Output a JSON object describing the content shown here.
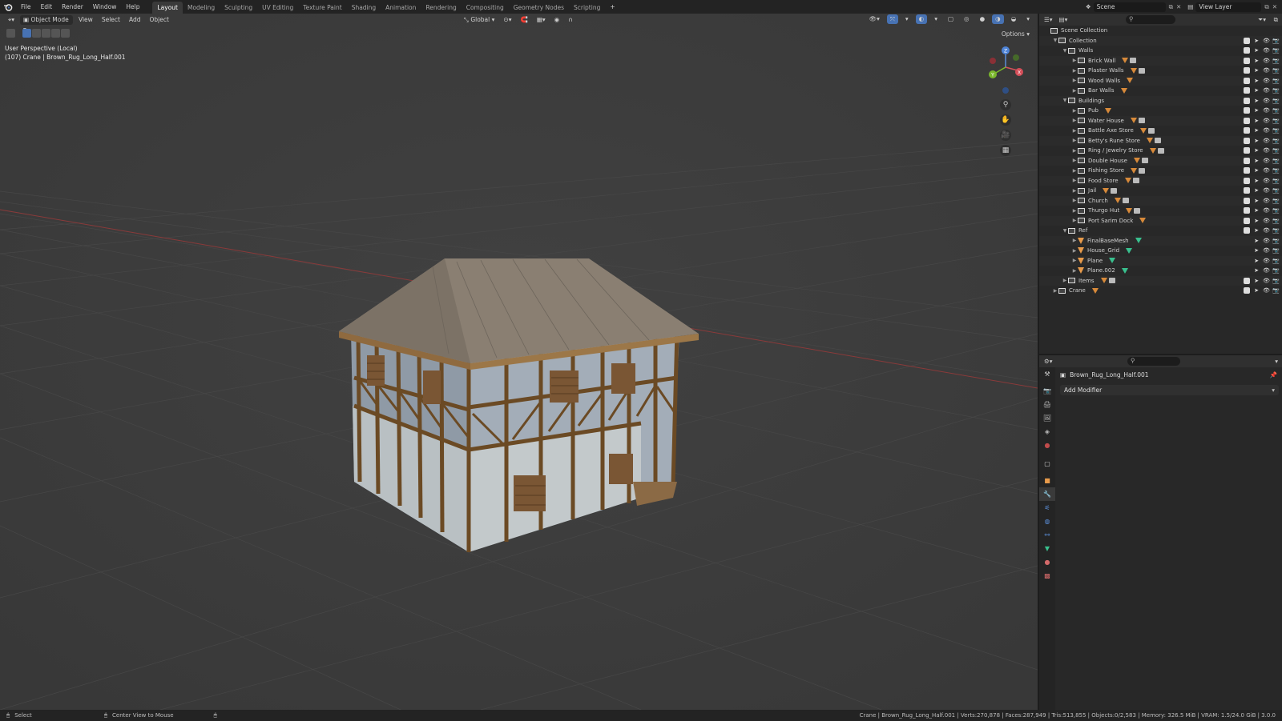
{
  "topbar": {
    "menus": [
      "File",
      "Edit",
      "Render",
      "Window",
      "Help"
    ],
    "workspaces": [
      "Layout",
      "Modeling",
      "Sculpting",
      "UV Editing",
      "Texture Paint",
      "Shading",
      "Animation",
      "Rendering",
      "Compositing",
      "Geometry Nodes",
      "Scripting"
    ],
    "active_workspace": "Layout",
    "add_tab": "+",
    "scene": "Scene",
    "view_layer": "View Layer"
  },
  "viewport": {
    "mode": "Object Mode",
    "menus": [
      "View",
      "Select",
      "Add",
      "Object"
    ],
    "orientation": "Global",
    "options": "Options",
    "info_line1": "User Perspective (Local)",
    "info_line2": "(107) Crane | Brown_Rug_Long_Half.001",
    "gizmo": {
      "z": "Z",
      "y": "Y",
      "x": "X"
    }
  },
  "outliner": {
    "root": "Scene Collection",
    "rows": [
      {
        "label": "Collection",
        "depth": 1,
        "type": "collection",
        "expanded": true
      },
      {
        "label": "Walls",
        "depth": 2,
        "type": "collection",
        "expanded": true
      },
      {
        "label": "Brick Wall",
        "depth": 3,
        "type": "collection",
        "extras": "mesh+box"
      },
      {
        "label": "Plaster Walls",
        "depth": 3,
        "type": "collection",
        "extras": "mesh+box"
      },
      {
        "label": "Wood Walls",
        "depth": 3,
        "type": "collection",
        "extras": "mesh"
      },
      {
        "label": "Bar Walls",
        "depth": 3,
        "type": "collection",
        "extras": "mesh"
      },
      {
        "label": "Buildings",
        "depth": 2,
        "type": "collection",
        "expanded": true
      },
      {
        "label": "Pub",
        "depth": 3,
        "type": "collection",
        "extras": "mesh"
      },
      {
        "label": "Water House",
        "depth": 3,
        "type": "collection",
        "extras": "mesh+box"
      },
      {
        "label": "Battle Axe Store",
        "depth": 3,
        "type": "collection",
        "extras": "mesh+box"
      },
      {
        "label": "Betty's Rune Store",
        "depth": 3,
        "type": "collection",
        "extras": "mesh+box"
      },
      {
        "label": "Ring / Jewelry Store",
        "depth": 3,
        "type": "collection",
        "extras": "mesh+box"
      },
      {
        "label": "Double House",
        "depth": 3,
        "type": "collection",
        "extras": "mesh+box"
      },
      {
        "label": "Fishing Store",
        "depth": 3,
        "type": "collection",
        "extras": "mesh+box"
      },
      {
        "label": "Food Store",
        "depth": 3,
        "type": "collection",
        "extras": "mesh+box"
      },
      {
        "label": "Jail",
        "depth": 3,
        "type": "collection",
        "extras": "mesh+box"
      },
      {
        "label": "Church",
        "depth": 3,
        "type": "collection",
        "extras": "mesh+box"
      },
      {
        "label": "Thurgo Hut",
        "depth": 3,
        "type": "collection",
        "extras": "mesh+box"
      },
      {
        "label": "Port Sarim Dock",
        "depth": 3,
        "type": "collection",
        "extras": "mesh"
      },
      {
        "label": "Ref",
        "depth": 2,
        "type": "collection",
        "expanded": true
      },
      {
        "label": "FinalBaseMesh",
        "depth": 3,
        "type": "mesh",
        "extras": "green"
      },
      {
        "label": "House_Grid",
        "depth": 3,
        "type": "mesh",
        "extras": "green"
      },
      {
        "label": "Plane",
        "depth": 3,
        "type": "mesh",
        "extras": "green"
      },
      {
        "label": "Plane.002",
        "depth": 3,
        "type": "mesh",
        "extras": "green"
      },
      {
        "label": "Items",
        "depth": 2,
        "type": "collection",
        "extras": "mesh+box"
      },
      {
        "label": "Crane",
        "depth": 1,
        "type": "collection",
        "extras": "mesh"
      }
    ]
  },
  "properties": {
    "object_name": "Brown_Rug_Long_Half.001",
    "add_modifier": "Add Modifier"
  },
  "statusbar": {
    "left_action": "Select",
    "middle_action": "Center View to Mouse",
    "stats": "Crane | Brown_Rug_Long_Half.001 | Verts:270,878 | Faces:287,949 | Tris:513,855 | Objects:0/2,583 | Memory: 326.5 MiB | VRAM: 1.5/24.0 GiB | 3.0.0"
  },
  "colors": {
    "accent": "#4772b3",
    "viewport_bg": "#3d3d3d",
    "panel_bg": "#282828",
    "mesh_icon": "#e89b4b",
    "object_data_icon": "#39c08e"
  }
}
